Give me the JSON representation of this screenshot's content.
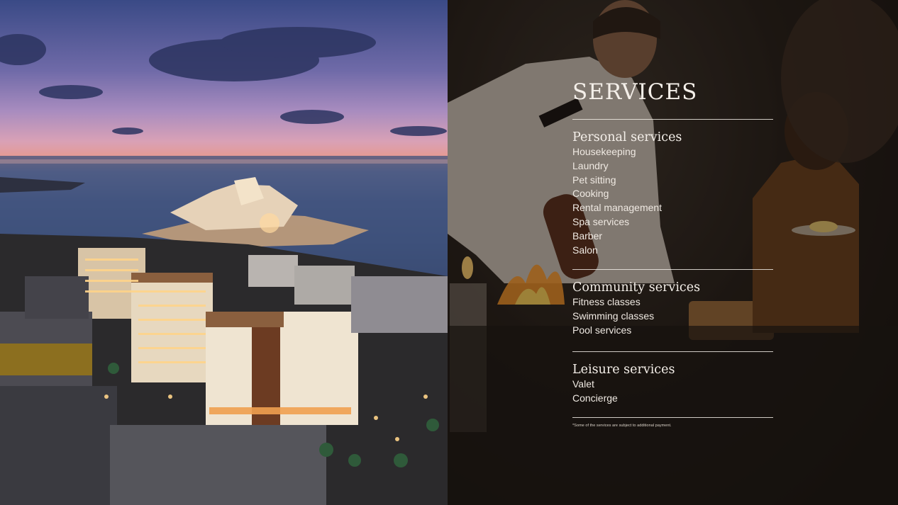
{
  "services": {
    "title": "SERVICES",
    "sections": [
      {
        "title": "Personal services",
        "items": [
          "Housekeeping",
          "Laundry",
          "Pet sitting",
          "Cooking",
          "Rental management",
          "Spa services",
          "Barber",
          "Salon"
        ]
      },
      {
        "title": "Community services",
        "items": [
          "Fitness classes",
          "Swimming classes",
          "Pool services"
        ]
      },
      {
        "title": "Leisure services",
        "items": [
          "Valet",
          "Concierge"
        ]
      }
    ],
    "footnote": "*Some of the services are subject to additional payment."
  },
  "photos": {
    "left": "aerial-coastal-development-at-dusk",
    "right": "chef-cooking-in-restaurant"
  },
  "colors": {
    "text": "#f4efe9",
    "rule": "#f0ebe4",
    "panel": "#151110"
  }
}
